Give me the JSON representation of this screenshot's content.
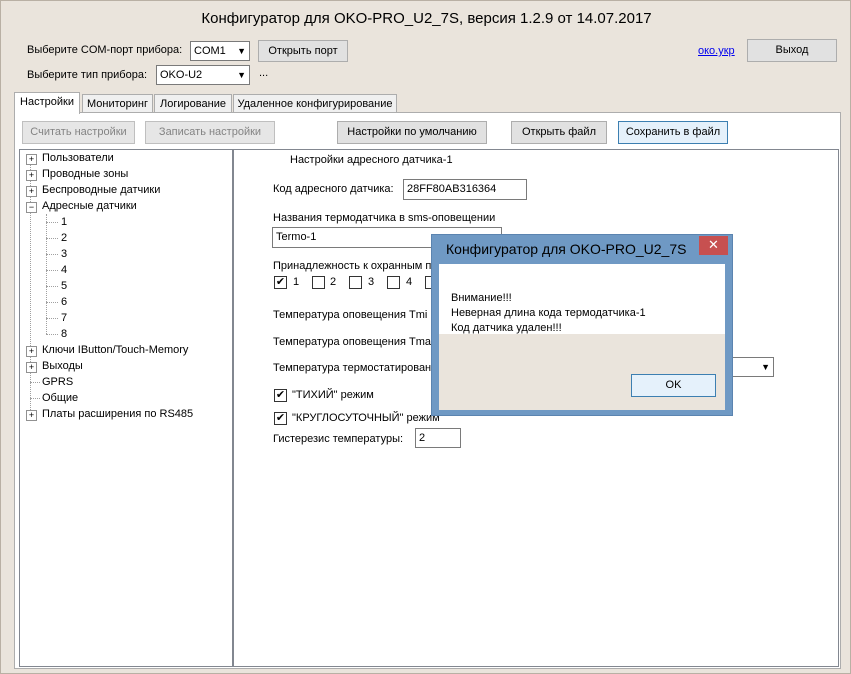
{
  "window": {
    "title": "Конфигуратор для OKO-PRO_U2_7S, версия 1.2.9 от 14.07.2017"
  },
  "header": {
    "com_label": "Выберите COM-порт прибора:",
    "com_value": "COM1",
    "open_port": "Открыть порт",
    "type_label": "Выберите тип прибора:",
    "type_value": "OKO-U2",
    "ellipsis": "...",
    "link": "око.укр",
    "exit": "Выход"
  },
  "tabs": [
    "Настройки",
    "Мониторинг",
    "Логирование",
    "Удаленное конфигурирование"
  ],
  "toolbar": {
    "read": "Считать настройки",
    "write": "Записать настройки",
    "defaults": "Настройки по умолчанию",
    "open_file": "Открыть файл",
    "save_file": "Сохранить в файл"
  },
  "tree": {
    "items": [
      "Пользователи",
      "Проводные зоны",
      "Беспроводные датчики",
      "Адресные датчики",
      "Ключи IButton/Touch-Memory",
      "Выходы",
      "GPRS",
      "Общие",
      "Платы расширения по RS485"
    ],
    "sub_items": [
      "1",
      "2",
      "3",
      "4",
      "5",
      "6",
      "7",
      "8"
    ]
  },
  "form": {
    "section_title": "Настройки адресного датчика-1",
    "code_label": "Код адресного датчика:",
    "code_value": "28FF80AB316364",
    "name_label": "Названия термодатчика в sms-оповещении",
    "name_value": "Termo-1",
    "zone_label": "Принадлежность к охранным п",
    "zones": [
      "1",
      "2",
      "3",
      "4"
    ],
    "tmin_label": "Температура оповещения Tmi",
    "tmax_label": "Температура оповещения Tma",
    "thermostat_label": "Температура термостатирован",
    "quiet_label": "\"ТИХИЙ\" режим",
    "round_label": "\"КРУГЛОСУТОЧНЫЙ\" режим",
    "hysteresis_label": "Гистерезис температуры:",
    "hysteresis_value": "2"
  },
  "dialog": {
    "title": "Конфигуратор для OKO-PRO_U2_7S",
    "close": "✕",
    "line1": "Внимание!!!",
    "line2": "Неверная длина кода термодатчика-1",
    "line3": "Код датчика удален!!!",
    "ok": "OK"
  }
}
